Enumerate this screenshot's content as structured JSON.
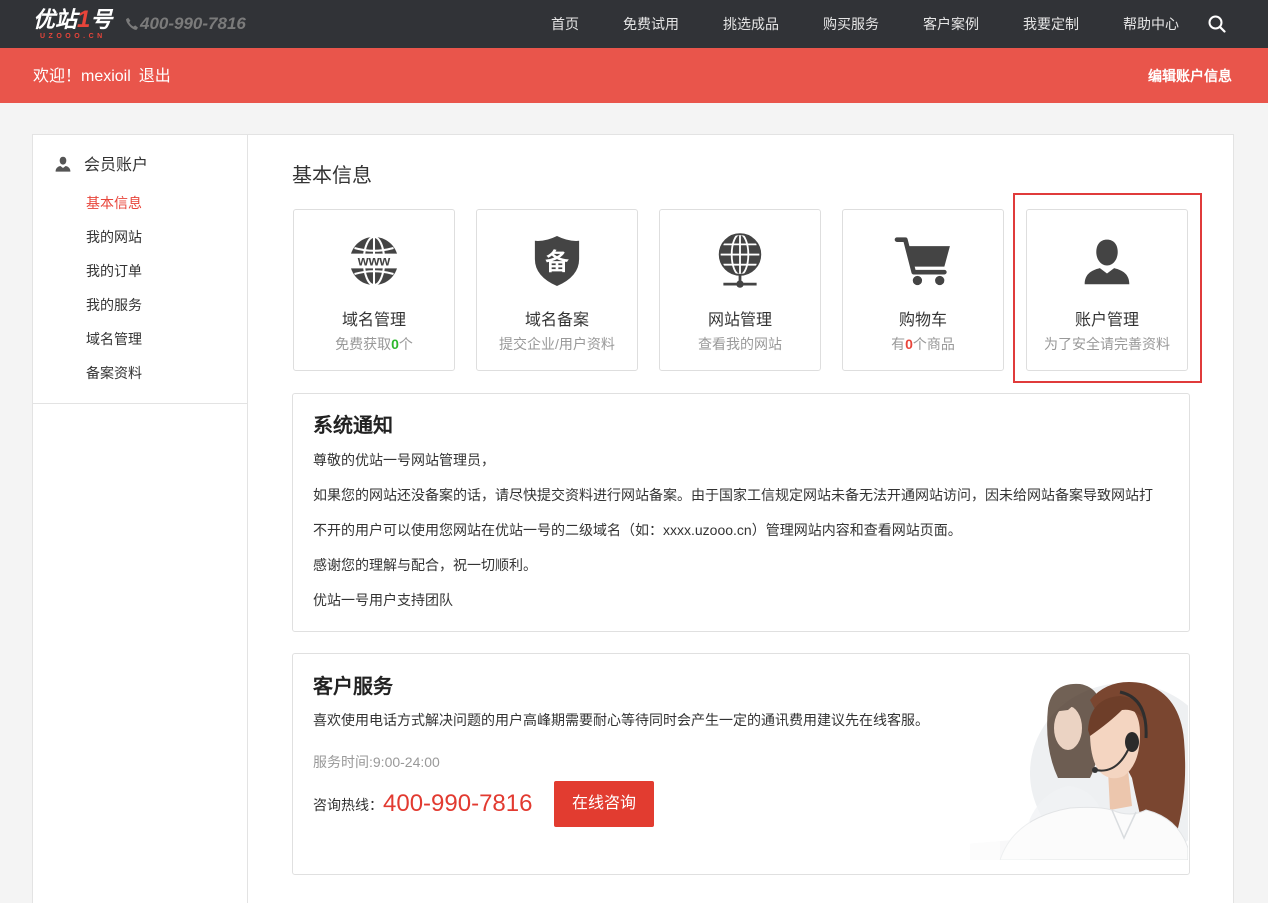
{
  "header": {
    "logo": {
      "text_a": "优站",
      "text_b": "1",
      "text_c": "号",
      "sub": "UZOOO.CN"
    },
    "phone": "400-990-7816",
    "nav": [
      {
        "label": "首页"
      },
      {
        "label": "免费试用"
      },
      {
        "label": "挑选成品"
      },
      {
        "label": "购买服务"
      },
      {
        "label": "客户案例"
      },
      {
        "label": "我要定制"
      },
      {
        "label": "帮助中心"
      }
    ],
    "icons": {
      "phone": "phone-icon",
      "search": "search-icon"
    }
  },
  "welcome_bar": {
    "greeting": "欢迎！mexioil",
    "logout": "退出",
    "edit_account": "编辑账户信息"
  },
  "sidebar": {
    "title": "会员账户",
    "title_icon": "user-icon",
    "items": [
      {
        "label": "基本信息",
        "active": true
      },
      {
        "label": "我的网站",
        "active": false
      },
      {
        "label": "我的订单",
        "active": false
      },
      {
        "label": "我的服务",
        "active": false
      },
      {
        "label": "域名管理",
        "active": false
      },
      {
        "label": "备案资料",
        "active": false
      }
    ]
  },
  "main": {
    "title": "基本信息",
    "cards": [
      {
        "icon": "www-globe-icon",
        "icon_text": "www",
        "title": "域名管理",
        "sub": "免费获取",
        "num": "0",
        "sub_end": "个",
        "num_color": "#2db82d"
      },
      {
        "icon": "beian-shield-icon",
        "icon_text": "备",
        "title": "域名备案",
        "sub": "提交企业/用户资料"
      },
      {
        "icon": "globe-network-icon",
        "title": "网站管理",
        "sub": "查看我的网站"
      },
      {
        "icon": "shopping-cart-icon",
        "title": "购物车",
        "sub": "有",
        "num": "0",
        "sub_end": "个商品",
        "num_color": "#e8443a"
      },
      {
        "icon": "user-icon",
        "title": "账户管理",
        "sub": "为了安全请完善资料",
        "highlighted": true
      }
    ]
  },
  "notice": {
    "title": "系统通知",
    "lines": [
      "尊敬的优站一号网站管理员，",
      "如果您的网站还没备案的话，请尽快提交资料进行网站备案。由于国家工信规定网站未备无法开通网站访问，因未给网站备案导致网站打",
      "不开的用户可以使用您网站在优站一号的二级域名（如：xxxx.uzooo.cn）管理网站内容和查看网站页面。",
      "感谢您的理解与配合，祝一切顺利。",
      "优站一号用户支持团队"
    ]
  },
  "service": {
    "title": "客户服务",
    "description": "喜欢使用电话方式解决问题的用户高峰期需要耐心等待同时会产生一定的通讯费用建议先在线客服。",
    "hours": "服务时间:9:00-24:00",
    "hotline_label": "咨询热线：",
    "hotline_number": "400-990-7816",
    "consult_button": "在线咨询",
    "photo": "customer-service-agents-photo"
  },
  "colors": {
    "header_bg": "#313337",
    "accent_red": "#e9554b",
    "highlight_border": "#e03b3b",
    "number_green": "#2db82d",
    "number_red": "#e8443a",
    "button_red": "#e23c30",
    "icon_gray": "#444444"
  }
}
